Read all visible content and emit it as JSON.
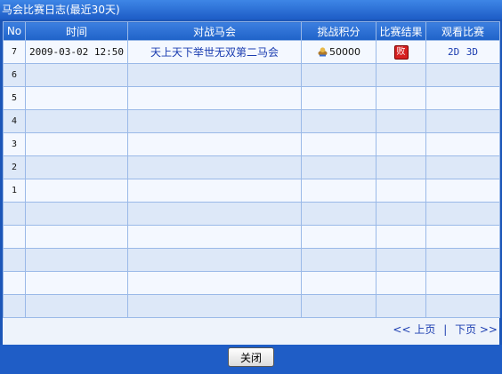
{
  "window": {
    "title": "马会比赛日志(最近30天)"
  },
  "columns": [
    "No",
    "时间",
    "对战马会",
    "挑战积分",
    "比赛结果",
    "观看比赛"
  ],
  "rows": [
    {
      "no": "7",
      "time": "2009-03-02 12:50",
      "opponent": "天上天下举世无双第二马会",
      "score": "50000",
      "result": "败",
      "watch2d": "2D",
      "watch3d": "3D"
    },
    {
      "no": "6"
    },
    {
      "no": "5"
    },
    {
      "no": "4"
    },
    {
      "no": "3"
    },
    {
      "no": "2"
    },
    {
      "no": "1"
    },
    {
      "no": ""
    },
    {
      "no": ""
    },
    {
      "no": ""
    },
    {
      "no": ""
    },
    {
      "no": ""
    }
  ],
  "pager": {
    "prev": "<< 上页",
    "sep": "|",
    "next": "下页 >>"
  },
  "buttons": {
    "close": "关闭"
  },
  "colors": {
    "titlebar": "#1d5cc6",
    "header": "#2a6ad4",
    "row_light": "#f4f8ff",
    "row_dark": "#dde8f8",
    "link": "#1a3cb0",
    "lose_badge": "#d62020"
  }
}
